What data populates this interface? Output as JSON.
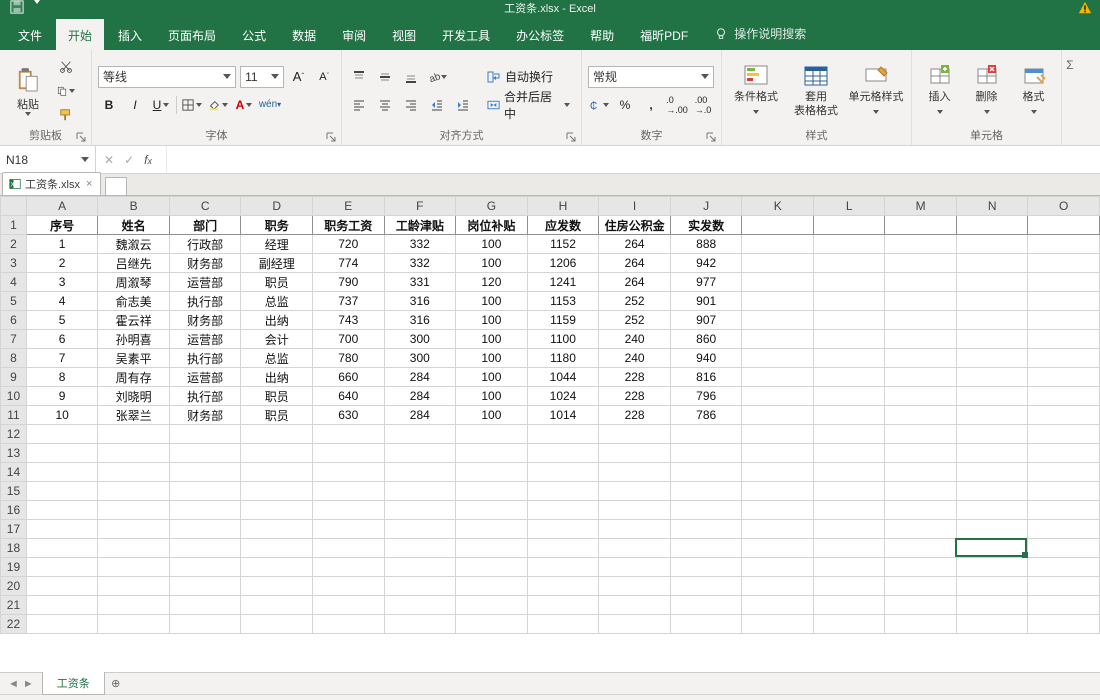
{
  "title_file": "工资条.xlsx",
  "title_app": "Excel",
  "tabs": {
    "file": "文件",
    "home": "开始",
    "insert": "插入",
    "page_layout": "页面布局",
    "formulas": "公式",
    "data": "数据",
    "review": "审阅",
    "view": "视图",
    "developer": "开发工具",
    "office_tab": "办公标签",
    "help": "帮助",
    "foxit": "福昕PDF",
    "tell_me": "操作说明搜索"
  },
  "ribbon": {
    "clipboard": {
      "paste": "粘贴",
      "label": "剪贴板"
    },
    "font": {
      "family": "等线",
      "size": "11",
      "label": "字体"
    },
    "alignment": {
      "wrap": "自动换行",
      "merge": "合并后居中",
      "label": "对齐方式"
    },
    "number": {
      "format": "常规",
      "label": "数字"
    },
    "styles": {
      "cond": "条件格式",
      "table": "套用\n表格格式",
      "cell": "单元格样式",
      "label": "样式"
    },
    "cells": {
      "insert": "插入",
      "delete": "删除",
      "format": "格式",
      "label": "单元格"
    }
  },
  "namebox": "N18",
  "workbook_tab": "工资条.xlsx",
  "columns": [
    "A",
    "B",
    "C",
    "D",
    "E",
    "F",
    "G",
    "H",
    "I",
    "J",
    "K",
    "L",
    "M",
    "N",
    "O"
  ],
  "headers": [
    "序号",
    "姓名",
    "部门",
    "职务",
    "职务工资",
    "工龄津贴",
    "岗位补贴",
    "应发数",
    "住房公积金",
    "实发数"
  ],
  "rows": [
    [
      "1",
      "魏溆云",
      "行政部",
      "经理",
      "720",
      "332",
      "100",
      "1152",
      "264",
      "888"
    ],
    [
      "2",
      "吕继先",
      "财务部",
      "副经理",
      "774",
      "332",
      "100",
      "1206",
      "264",
      "942"
    ],
    [
      "3",
      "周溆琴",
      "运营部",
      "职员",
      "790",
      "331",
      "120",
      "1241",
      "264",
      "977"
    ],
    [
      "4",
      "俞志美",
      "执行部",
      "总监",
      "737",
      "316",
      "100",
      "1153",
      "252",
      "901"
    ],
    [
      "5",
      "霍云祥",
      "财务部",
      "出纳",
      "743",
      "316",
      "100",
      "1159",
      "252",
      "907"
    ],
    [
      "6",
      "孙明喜",
      "运营部",
      "会计",
      "700",
      "300",
      "100",
      "1100",
      "240",
      "860"
    ],
    [
      "7",
      "吴素平",
      "执行部",
      "总监",
      "780",
      "300",
      "100",
      "1180",
      "240",
      "940"
    ],
    [
      "8",
      "周有存",
      "运营部",
      "出纳",
      "660",
      "284",
      "100",
      "1044",
      "228",
      "816"
    ],
    [
      "9",
      "刘晓明",
      "执行部",
      "职员",
      "640",
      "284",
      "100",
      "1024",
      "228",
      "796"
    ],
    [
      "10",
      "张翠兰",
      "财务部",
      "职员",
      "630",
      "284",
      "100",
      "1014",
      "228",
      "786"
    ]
  ],
  "sheet_tab": "工资条",
  "chart_data": {
    "type": "table",
    "title": "工资条",
    "columns": [
      "序号",
      "姓名",
      "部门",
      "职务",
      "职务工资",
      "工龄津贴",
      "岗位补贴",
      "应发数",
      "住房公积金",
      "实发数"
    ],
    "rows": [
      [
        1,
        "魏溆云",
        "行政部",
        "经理",
        720,
        332,
        100,
        1152,
        264,
        888
      ],
      [
        2,
        "吕继先",
        "财务部",
        "副经理",
        774,
        332,
        100,
        1206,
        264,
        942
      ],
      [
        3,
        "周溆琴",
        "运营部",
        "职员",
        790,
        331,
        120,
        1241,
        264,
        977
      ],
      [
        4,
        "俞志美",
        "执行部",
        "总监",
        737,
        316,
        100,
        1153,
        252,
        901
      ],
      [
        5,
        "霍云祥",
        "财务部",
        "出纳",
        743,
        316,
        100,
        1159,
        252,
        907
      ],
      [
        6,
        "孙明喜",
        "运营部",
        "会计",
        700,
        300,
        100,
        1100,
        240,
        860
      ],
      [
        7,
        "吴素平",
        "执行部",
        "总监",
        780,
        300,
        100,
        1180,
        240,
        940
      ],
      [
        8,
        "周有存",
        "运营部",
        "出纳",
        660,
        284,
        100,
        1044,
        228,
        816
      ],
      [
        9,
        "刘晓明",
        "执行部",
        "职员",
        640,
        284,
        100,
        1024,
        228,
        796
      ],
      [
        10,
        "张翠兰",
        "财务部",
        "职员",
        630,
        284,
        100,
        1014,
        228,
        786
      ]
    ]
  }
}
